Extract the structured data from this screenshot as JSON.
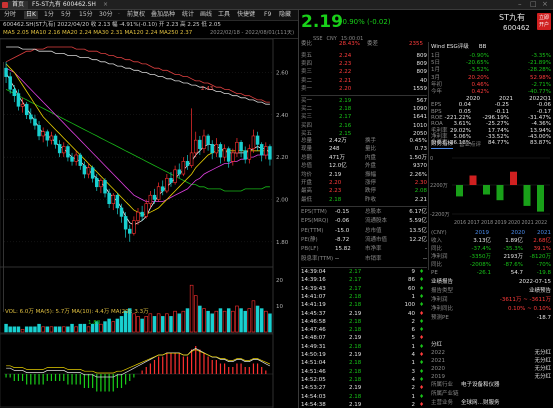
{
  "titlebar": {
    "app_tab": "首页",
    "stock_tab": "F5-ST九有 600462.SH"
  },
  "menubar": {
    "items": [
      "分时",
      "日K",
      "1分",
      "5分",
      "15分",
      "30分",
      "·",
      "前复权",
      "叠加品种",
      "统计",
      "画线",
      "工具",
      "快捷键",
      "F9",
      "隐藏"
    ]
  },
  "info": {
    "line1": "600462.SH(ST九有)  2022/04/20  收 2.13  幅 -4.91%(-0.10)  开 2.23  高 2.25  低 2.05",
    "line2": "MA5 2.05  MA10 2.16  MA20 2.24  MA30 2.31  MA120 2.24  MA250 2.37",
    "range": "2022/02/18 - 2022/08/01(111天)"
  },
  "chart_data": {
    "type": "candlestick",
    "price_ticks": [
      "2.60",
      "2.40",
      "2.20",
      "2.00",
      "1.80"
    ],
    "annotation_high": "2.43",
    "annotation_low": "1.80",
    "ylim": [
      1.7,
      2.72
    ],
    "candles": [
      [
        2.62,
        2.58,
        2.65,
        2.55
      ],
      [
        2.58,
        2.52,
        2.6,
        2.5
      ],
      [
        2.52,
        2.49,
        2.54,
        2.46
      ],
      [
        2.5,
        2.44,
        2.52,
        2.42
      ],
      [
        2.44,
        2.45,
        2.48,
        2.41
      ],
      [
        2.45,
        2.4,
        2.46,
        2.38
      ],
      [
        2.4,
        2.38,
        2.43,
        2.36
      ],
      [
        2.38,
        2.35,
        2.4,
        2.33
      ],
      [
        2.35,
        2.3,
        2.37,
        2.28
      ],
      [
        2.3,
        2.32,
        2.34,
        2.27
      ],
      [
        2.32,
        2.28,
        2.33,
        2.25
      ],
      [
        2.28,
        2.3,
        2.32,
        2.26
      ],
      [
        2.3,
        2.26,
        2.31,
        2.24
      ],
      [
        2.26,
        2.22,
        2.28,
        2.2
      ],
      [
        2.22,
        2.25,
        2.27,
        2.2
      ],
      [
        2.25,
        2.2,
        2.26,
        2.18
      ],
      [
        2.2,
        2.18,
        2.22,
        2.16
      ],
      [
        2.18,
        2.21,
        2.23,
        2.16
      ],
      [
        2.21,
        2.16,
        2.22,
        2.14
      ],
      [
        2.16,
        2.12,
        2.18,
        2.1
      ],
      [
        2.12,
        2.15,
        2.17,
        2.1
      ],
      [
        2.15,
        2.1,
        2.16,
        2.08
      ],
      [
        2.1,
        2.06,
        2.12,
        2.04
      ],
      [
        2.06,
        2.09,
        2.1,
        2.03
      ],
      [
        2.09,
        2.03,
        2.1,
        2.01
      ],
      [
        2.03,
        1.98,
        2.05,
        1.96
      ],
      [
        1.98,
        2.02,
        2.03,
        1.95
      ],
      [
        2.02,
        1.96,
        2.03,
        1.93
      ],
      [
        1.96,
        1.92,
        1.98,
        1.89
      ],
      [
        1.92,
        1.86,
        1.94,
        1.82
      ],
      [
        1.86,
        1.84,
        1.88,
        1.8
      ],
      [
        1.84,
        1.9,
        1.92,
        1.83
      ],
      [
        1.9,
        1.94,
        1.96,
        1.88
      ],
      [
        1.94,
        1.92,
        1.97,
        1.9
      ],
      [
        1.92,
        1.98,
        2.0,
        1.91
      ],
      [
        1.98,
        2.02,
        2.04,
        1.96
      ],
      [
        2.02,
        2.0,
        2.05,
        1.98
      ],
      [
        2.0,
        2.06,
        2.08,
        1.99
      ],
      [
        2.06,
        2.04,
        2.09,
        2.02
      ],
      [
        2.04,
        2.1,
        2.12,
        2.03
      ],
      [
        2.1,
        2.08,
        2.13,
        2.06
      ],
      [
        2.08,
        2.14,
        2.16,
        2.07
      ],
      [
        2.14,
        2.12,
        2.17,
        2.1
      ],
      [
        2.12,
        2.18,
        2.2,
        2.11
      ],
      [
        2.18,
        2.16,
        2.21,
        2.14
      ],
      [
        2.16,
        2.22,
        2.43,
        2.15
      ],
      [
        2.22,
        2.28,
        2.32,
        2.2
      ],
      [
        2.28,
        2.24,
        2.3,
        2.21
      ],
      [
        2.24,
        2.3,
        2.33,
        2.22
      ],
      [
        2.3,
        2.26,
        2.31,
        2.23
      ],
      [
        2.26,
        2.22,
        2.28,
        2.19
      ],
      [
        2.22,
        2.26,
        2.29,
        2.2
      ],
      [
        2.26,
        2.2,
        2.27,
        2.17
      ],
      [
        2.2,
        2.24,
        2.26,
        2.18
      ],
      [
        2.24,
        2.18,
        2.25,
        2.15
      ],
      [
        2.18,
        2.22,
        2.24,
        2.16
      ],
      [
        2.22,
        2.27,
        2.29,
        2.2
      ],
      [
        2.27,
        2.23,
        2.28,
        2.2
      ],
      [
        2.23,
        2.19,
        2.25,
        2.17
      ],
      [
        2.19,
        2.24,
        2.26,
        2.17
      ],
      [
        2.24,
        2.3,
        2.33,
        2.22
      ],
      [
        2.3,
        2.26,
        2.32,
        2.23
      ],
      [
        2.26,
        2.21,
        2.27,
        2.18
      ],
      [
        2.21,
        2.25,
        2.27,
        2.19
      ],
      [
        2.25,
        2.19,
        2.26,
        2.16
      ]
    ],
    "ma5": [
      2.6,
      2.56,
      2.53,
      2.49,
      2.46,
      2.43,
      2.4,
      2.37,
      2.34,
      2.31,
      2.3,
      2.29,
      2.27,
      2.25,
      2.24,
      2.22,
      2.2,
      2.19,
      2.18,
      2.16,
      2.14,
      2.12,
      2.1,
      2.08,
      2.06,
      2.03,
      2.01,
      1.99,
      1.96,
      1.92,
      1.89,
      1.88,
      1.89,
      1.9,
      1.92,
      1.96,
      1.99,
      2.02,
      2.04,
      2.06,
      2.08,
      2.1,
      2.12,
      2.14,
      2.16,
      2.18,
      2.21,
      2.23,
      2.25,
      2.26,
      2.26,
      2.25,
      2.24,
      2.23,
      2.22,
      2.22,
      2.22,
      2.22,
      2.22,
      2.23,
      2.24,
      2.25,
      2.24,
      2.24,
      2.22
    ],
    "ma10": [
      2.64,
      2.62,
      2.6,
      2.57,
      2.54,
      2.51,
      2.48,
      2.45,
      2.42,
      2.39,
      2.37,
      2.35,
      2.33,
      2.31,
      2.29,
      2.27,
      2.25,
      2.23,
      2.21,
      2.19,
      2.17,
      2.15,
      2.13,
      2.11,
      2.09,
      2.07,
      2.05,
      2.03,
      2.01,
      1.99,
      1.97,
      1.95,
      1.94,
      1.93,
      1.93,
      1.94,
      1.95,
      1.96,
      1.98,
      2.0,
      2.02,
      2.04,
      2.06,
      2.08,
      2.1,
      2.12,
      2.15,
      2.17,
      2.19,
      2.21,
      2.22,
      2.23,
      2.23,
      2.23,
      2.23,
      2.23,
      2.23,
      2.23,
      2.23,
      2.23,
      2.23,
      2.23,
      2.23,
      2.23,
      2.23
    ],
    "ma20": [
      2.62,
      2.61,
      2.6,
      2.58,
      2.56,
      2.54,
      2.52,
      2.5,
      2.48,
      2.46,
      2.44,
      2.42,
      2.4,
      2.38,
      2.36,
      2.34,
      2.32,
      2.3,
      2.28,
      2.26,
      2.24,
      2.22,
      2.2,
      2.18,
      2.16,
      2.14,
      2.12,
      2.1,
      2.08,
      2.06,
      2.04,
      2.02,
      2.01,
      2.0,
      1.99,
      1.99,
      1.99,
      1.99,
      1.99,
      2.0,
      2.01,
      2.02,
      2.03,
      2.04,
      2.05,
      2.07,
      2.09,
      2.1,
      2.12,
      2.13,
      2.14,
      2.15,
      2.16,
      2.17,
      2.17,
      2.18,
      2.18,
      2.19,
      2.19,
      2.2,
      2.2,
      2.21,
      2.21,
      2.21,
      2.21
    ],
    "ma60": [
      2.52,
      2.51,
      2.5,
      2.49,
      2.48,
      2.47,
      2.46,
      2.45,
      2.44,
      2.43,
      2.42,
      2.41,
      2.4,
      2.39,
      2.38,
      2.37,
      2.36,
      2.35,
      2.34,
      2.33,
      2.32,
      2.31,
      2.3,
      2.29,
      2.28,
      2.27,
      2.26,
      2.25,
      2.24,
      2.23,
      2.22,
      2.21,
      2.2,
      2.19,
      2.18,
      2.17,
      2.16,
      2.15,
      2.14,
      2.13,
      2.12,
      2.11,
      2.1,
      2.09,
      2.08,
      2.07,
      2.07,
      2.06,
      2.06,
      2.05,
      2.05,
      2.05,
      2.05,
      2.04,
      2.04,
      2.04,
      2.04,
      2.04,
      2.05,
      2.05,
      2.05,
      2.05,
      2.05,
      2.06,
      2.06
    ],
    "ma120": [
      2.72,
      2.72,
      2.72,
      2.72,
      2.71,
      2.71,
      2.71,
      2.71,
      2.7,
      2.7,
      2.7,
      2.7,
      2.69,
      2.69,
      2.69,
      2.68,
      2.68,
      2.68,
      2.67,
      2.67,
      2.67,
      2.66,
      2.66,
      2.65,
      2.65,
      2.64,
      2.64,
      2.63,
      2.63,
      2.62,
      2.62,
      2.61,
      2.61,
      2.6,
      2.6,
      2.59,
      2.59,
      2.58,
      2.58,
      2.57,
      2.57,
      2.56,
      2.56,
      2.55,
      2.55,
      2.54,
      2.54,
      2.53,
      2.53,
      2.52,
      2.52,
      2.51,
      2.51,
      2.5,
      2.5,
      2.49,
      2.49,
      2.48,
      2.48,
      2.47,
      2.47,
      2.46,
      2.46,
      2.45,
      2.45
    ],
    "ma250": [
      2.65,
      2.66,
      2.67,
      2.68,
      2.69,
      2.7,
      2.7,
      2.71,
      2.71,
      2.71,
      2.72,
      2.72,
      2.72,
      2.72,
      2.72,
      2.72,
      2.72,
      2.71,
      2.71,
      2.71,
      2.7,
      2.7,
      2.7,
      2.69,
      2.69,
      2.68,
      2.68,
      2.67,
      2.67,
      2.66,
      2.66,
      2.65,
      2.65,
      2.64,
      2.64,
      2.63,
      2.62,
      2.62,
      2.61,
      2.61,
      2.6,
      2.59,
      2.59,
      2.58,
      2.58,
      2.57,
      2.56,
      2.56,
      2.55,
      2.55,
      2.54,
      2.53,
      2.53,
      2.52,
      2.52,
      2.51,
      2.5,
      2.5,
      2.49,
      2.49,
      2.48,
      2.47,
      2.47,
      2.46,
      2.46
    ],
    "volume_label": "VOL: 6.0万  MA(5): 5.7万  MA(10): 4.4万  MA(20): 3.3万",
    "volumes": [
      3,
      2,
      2,
      2,
      1,
      2,
      2,
      2,
      3,
      2,
      2,
      2,
      2,
      2,
      2,
      2,
      3,
      2,
      3,
      3,
      2,
      3,
      4,
      3,
      4,
      5,
      4,
      5,
      6,
      8,
      9,
      7,
      6,
      5,
      6,
      7,
      6,
      7,
      6,
      7,
      6,
      8,
      7,
      8,
      9,
      18,
      14,
      10,
      9,
      8,
      7,
      8,
      9,
      8,
      9,
      8,
      10,
      9,
      8,
      9,
      12,
      10,
      9,
      8,
      7
    ],
    "vol_ticks": [
      "20",
      "10"
    ],
    "macd_values": [
      -1,
      -1,
      -2,
      -2,
      -2,
      -3,
      -3,
      -3,
      -3,
      -3,
      -2,
      -2,
      -2,
      -2,
      -2,
      -3,
      -3,
      -3,
      -3,
      -4,
      -4,
      -4,
      -5,
      -5,
      -5,
      -5,
      -5,
      -4,
      -4,
      -3,
      -2,
      -1,
      0,
      1,
      2,
      3,
      4,
      5,
      5,
      6,
      6,
      6,
      6,
      5,
      5,
      7,
      8,
      7,
      6,
      5,
      4,
      4,
      3,
      3,
      2,
      2,
      3,
      3,
      2,
      2,
      3,
      3,
      2,
      1,
      0
    ]
  },
  "quote": {
    "price": "2.19",
    "change": "-0.90% (-0.02)",
    "name": "ST九有",
    "code": "600462",
    "badge_line1": "立即",
    "badge_line2": "开户",
    "tabs": [
      "SSE",
      "CNY",
      "15:00:01"
    ],
    "book_head": {
      "left": "委比",
      "left_val": "28.43%",
      "mid": "委差",
      "right_val": "2355"
    },
    "f10_tabs": [
      "Wind ESG评级",
      "BB"
    ],
    "asks": [
      {
        "label": "卖五",
        "price": "2.24",
        "vol": "809"
      },
      {
        "label": "卖四",
        "price": "2.23",
        "vol": "809"
      },
      {
        "label": "卖三",
        "price": "2.22",
        "vol": "809"
      },
      {
        "label": "卖二",
        "price": "2.21",
        "vol": "40"
      },
      {
        "label": "卖一",
        "price": "2.20",
        "vol": "1559"
      }
    ],
    "bids": [
      {
        "label": "买一",
        "price": "2.19",
        "vol": "567"
      },
      {
        "label": "买二",
        "price": "2.18",
        "vol": "1090"
      },
      {
        "label": "买三",
        "price": "2.17",
        "vol": "1641"
      },
      {
        "label": "买四",
        "price": "2.16",
        "vol": "1010"
      },
      {
        "label": "买五",
        "price": "2.15",
        "vol": "2050"
      }
    ],
    "perf": [
      {
        "k": "1日",
        "a": "-0.90%",
        "b": "-3.35%"
      },
      {
        "k": "5日",
        "a": "-20.65%",
        "b": "-21.89%"
      },
      {
        "k": "1月",
        "a": "-3.52%",
        "b": "-28.28%"
      },
      {
        "k": "3月",
        "a": "20.20%",
        "b": "52.98%"
      },
      {
        "k": "年初",
        "a": "0.46%",
        "b": "-2.71%"
      },
      {
        "k": "今年",
        "a": "0.42%",
        "b": "-40.77%"
      }
    ],
    "fin_head": [
      "",
      "2020",
      "2021",
      "2022Q1"
    ],
    "fin": [
      {
        "k": "EPS",
        "a": "0.04",
        "b": "-0.25",
        "c": "-0.06"
      },
      {
        "k": "BPS",
        "a": "0.05",
        "b": "-0.11",
        "c": "-0.17"
      },
      {
        "k": "ROE",
        "a": "-221.22%",
        "b": "-296.19%",
        "c": "-31.47%"
      },
      {
        "k": "ROA",
        "a": "3.61%",
        "b": "-25.27%",
        "c": "-4.36%"
      },
      {
        "k": "毛利率",
        "a": "29.02%",
        "b": "17.74%",
        "c": "13.94%"
      },
      {
        "k": "净利率",
        "a": "5.06%",
        "b": "-33.52%",
        "c": "-43.00%"
      },
      {
        "k": "负债率",
        "a": "86.18%",
        "b": "84.77%",
        "c": "83.87%"
      }
    ],
    "stats": [
      {
        "l": "总量",
        "lv": "2.42万",
        "r": "换手",
        "rv": "0.45%"
      },
      {
        "l": "现量",
        "lv": "248",
        "r": "量比",
        "rv": "0.73"
      },
      {
        "l": "总额",
        "lv": "471万",
        "r": "内盘",
        "rv": "1.50万"
      },
      {
        "l": "总值",
        "lv": "12.0亿",
        "r": "外盘",
        "rv": "9370"
      },
      {
        "l": "均价",
        "lv": "2.19",
        "r": "振幅",
        "rv": "2.26%"
      },
      {
        "l": "开盘",
        "lv": "2.20",
        "r": "涨停",
        "rv": "2.30"
      },
      {
        "l": "最高",
        "lv": "2.23",
        "r": "跌停",
        "rv": "2.08"
      },
      {
        "l": "最低",
        "lv": "2.18",
        "r": "昨收",
        "rv": "2.21"
      }
    ],
    "val": [
      {
        "l": "EPS(TTM)",
        "lv": "-0.15",
        "r": "总股本",
        "rv": "6.17亿"
      },
      {
        "l": "EPS(MRQ)",
        "lv": "-0.06",
        "r": "流通股本",
        "rv": "5.59亿"
      },
      {
        "l": "PE(TTM)",
        "lv": "-15.0",
        "r": "总市值",
        "rv": "13.5亿"
      },
      {
        "l": "PE(静)",
        "lv": "-8.72",
        "r": "流通市值",
        "rv": "12.2亿"
      },
      {
        "l": "PB(LF)",
        "lv": "15.82",
        "r": "市净率",
        "rv": "-"
      },
      {
        "l": "股息率(TTM)",
        "lv": "--",
        "r": "市销率",
        "rv": "--"
      }
    ],
    "ticks": [
      {
        "t": "14:39:04",
        "p": "2.17",
        "v": "9"
      },
      {
        "t": "14:39:16",
        "p": "2.17",
        "v": "86"
      },
      {
        "t": "14:39:43",
        "p": "2.17",
        "v": "60"
      },
      {
        "t": "14:41:07",
        "p": "2.18",
        "v": "1"
      },
      {
        "t": "14:41:19",
        "p": "2.18",
        "v": "100"
      },
      {
        "t": "14:45:37",
        "p": "2.19",
        "v": "40"
      },
      {
        "t": "14:46:58",
        "p": "2.18",
        "v": "2"
      },
      {
        "t": "14:47:46",
        "p": "2.18",
        "v": "6"
      },
      {
        "t": "14:48:07",
        "p": "2.19",
        "v": "5"
      },
      {
        "t": "14:49:31",
        "p": "2.18",
        "v": "1"
      },
      {
        "t": "14:50:19",
        "p": "2.19",
        "v": "4"
      },
      {
        "t": "14:51:04",
        "p": "2.18",
        "v": "1"
      },
      {
        "t": "14:51:46",
        "p": "2.18",
        "v": "3"
      },
      {
        "t": "14:52:05",
        "p": "2.18",
        "v": "4"
      },
      {
        "t": "14:53:27",
        "p": "2.19",
        "v": "2"
      },
      {
        "t": "14:54:03",
        "p": "2.18",
        "v": "1"
      },
      {
        "t": "14:54:38",
        "p": "2.19",
        "v": "2"
      }
    ],
    "fund_tabs": [
      "财务指标",
      "营业点评"
    ],
    "bar_units": [
      "2200万",
      "0",
      "-2200万"
    ],
    "years": [
      "2016",
      "2017",
      "2018",
      "2019",
      "2020",
      "2021",
      "2022"
    ],
    "bars": [
      -30,
      25,
      -25,
      -40,
      35,
      -55,
      -70
    ],
    "ptabs": [
      "(CNY)",
      "2019",
      "2020",
      "2021"
    ],
    "profit": [
      {
        "k": "收入",
        "a": "3.13亿",
        "b": "1.89亿",
        "c": "2.68亿"
      },
      {
        "k": "同比",
        "a": "-37.4%",
        "b": "-35.3%",
        "c": "39.1%"
      },
      {
        "k": "净利润",
        "a": "-3350万",
        "b": "2193万",
        "c": "-8120万"
      },
      {
        "k": "同比",
        "a": "-2008%",
        "b": "-87.6%",
        "c": "-70%"
      },
      {
        "k": "PE",
        "a": "-26.1",
        "b": "54.7",
        "c": "-19.8"
      }
    ],
    "report": {
      "title": "业绩报告",
      "date": "2022-07-15",
      "type": "报告类型",
      "type_v": "业绩预告",
      "profit_l": "净利润",
      "profit_v": "-3611万 ~ -3611万",
      "yoy_l": "净利同比",
      "yoy_v": "0.10% ~ 0.10%",
      "pe_l": "预测PE",
      "pe_v": "-18.7"
    },
    "dividend": {
      "title": "分红",
      "rows": [
        [
          "2022",
          "无分红"
        ],
        [
          "2021",
          "无分红"
        ],
        [
          "2020",
          "无分红"
        ],
        [
          "2019",
          "无分红"
        ]
      ]
    },
    "industry": {
      "l1": "所属行业",
      "v1": "电子设备和仪器",
      "l2": "所属产业链",
      "v2": "",
      "l3": "主营业务",
      "v3": "全球网…财服务"
    }
  }
}
